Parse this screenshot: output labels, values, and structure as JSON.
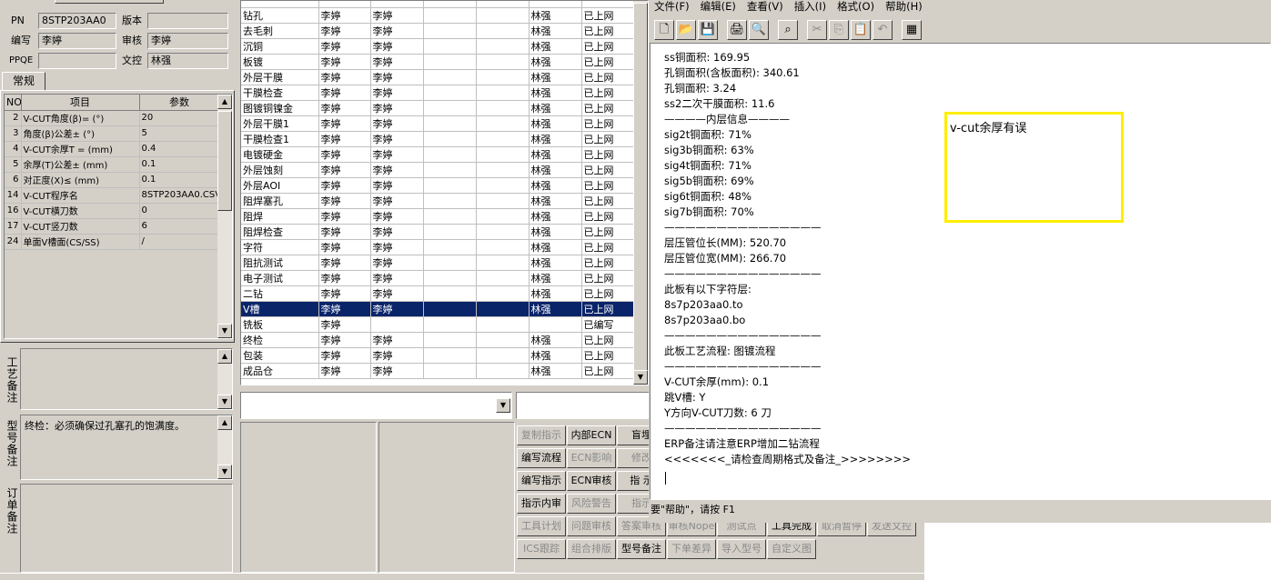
{
  "header": {
    "pn_label": "PN",
    "pn_value": "8STP203AA0",
    "version_label": "版本",
    "version_value": "",
    "author_label": "编写",
    "author_value": "李婷",
    "review_label": "审核",
    "review_value": "李婷",
    "ppqe_label": "PPQE",
    "ppqe_value": "",
    "doc_ctrl_label": "文控",
    "doc_ctrl_value": "林强"
  },
  "left_tab": "常规",
  "params": {
    "headers": [
      "NO",
      "项目",
      "参数"
    ],
    "rows": [
      {
        "no": "2",
        "item": "V-CUT角度(β)=  (°)",
        "value": "20"
      },
      {
        "no": "3",
        "item": "角度(β)公差±  (°)",
        "value": "5"
      },
      {
        "no": "4",
        "item": "V-CUT余厚T =  (mm)",
        "value": "0.4"
      },
      {
        "no": "5",
        "item": "余厚(T)公差±  (mm)",
        "value": "0.1"
      },
      {
        "no": "6",
        "item": "对正度(X)≤  (mm)",
        "value": "0.1"
      },
      {
        "no": "14",
        "item": "V-CUT程序名",
        "value": "8STP203AA0.CSV"
      },
      {
        "no": "16",
        "item": "V-CUT横刀数",
        "value": "0"
      },
      {
        "no": "17",
        "item": "V-CUT竖刀数",
        "value": "6"
      },
      {
        "no": "24",
        "item": "单面V槽面(CS/SS)",
        "value": "/"
      }
    ]
  },
  "notes": {
    "process_label": "工艺备注",
    "process_text": "",
    "model_label": "型号备注",
    "model_text": "终检：必须确保过孔塞孔的饱满度。",
    "order_label": "订单备注",
    "order_text": ""
  },
  "processes": [
    {
      "name": "钻孔",
      "a": "李婷",
      "b": "李婷",
      "c": "",
      "d": "",
      "e": "林强",
      "status": "已上网"
    },
    {
      "name": "去毛刺",
      "a": "李婷",
      "b": "李婷",
      "c": "",
      "d": "",
      "e": "林强",
      "status": "已上网"
    },
    {
      "name": "沉铜",
      "a": "李婷",
      "b": "李婷",
      "c": "",
      "d": "",
      "e": "林强",
      "status": "已上网"
    },
    {
      "name": "板镀",
      "a": "李婷",
      "b": "李婷",
      "c": "",
      "d": "",
      "e": "林强",
      "status": "已上网"
    },
    {
      "name": "外层干膜",
      "a": "李婷",
      "b": "李婷",
      "c": "",
      "d": "",
      "e": "林强",
      "status": "已上网"
    },
    {
      "name": "干膜检查",
      "a": "李婷",
      "b": "李婷",
      "c": "",
      "d": "",
      "e": "林强",
      "status": "已上网"
    },
    {
      "name": "图镀铜镍金",
      "a": "李婷",
      "b": "李婷",
      "c": "",
      "d": "",
      "e": "林强",
      "status": "已上网"
    },
    {
      "name": "外层干膜1",
      "a": "李婷",
      "b": "李婷",
      "c": "",
      "d": "",
      "e": "林强",
      "status": "已上网"
    },
    {
      "name": "干膜检查1",
      "a": "李婷",
      "b": "李婷",
      "c": "",
      "d": "",
      "e": "林强",
      "status": "已上网"
    },
    {
      "name": "电镀硬金",
      "a": "李婷",
      "b": "李婷",
      "c": "",
      "d": "",
      "e": "林强",
      "status": "已上网"
    },
    {
      "name": "外层蚀刻",
      "a": "李婷",
      "b": "李婷",
      "c": "",
      "d": "",
      "e": "林强",
      "status": "已上网"
    },
    {
      "name": "外层AOI",
      "a": "李婷",
      "b": "李婷",
      "c": "",
      "d": "",
      "e": "林强",
      "status": "已上网"
    },
    {
      "name": "阻焊塞孔",
      "a": "李婷",
      "b": "李婷",
      "c": "",
      "d": "",
      "e": "林强",
      "status": "已上网"
    },
    {
      "name": "阻焊",
      "a": "李婷",
      "b": "李婷",
      "c": "",
      "d": "",
      "e": "林强",
      "status": "已上网"
    },
    {
      "name": "阻焊检查",
      "a": "李婷",
      "b": "李婷",
      "c": "",
      "d": "",
      "e": "林强",
      "status": "已上网"
    },
    {
      "name": "字符",
      "a": "李婷",
      "b": "李婷",
      "c": "",
      "d": "",
      "e": "林强",
      "status": "已上网"
    },
    {
      "name": "阻抗测试",
      "a": "李婷",
      "b": "李婷",
      "c": "",
      "d": "",
      "e": "林强",
      "status": "已上网"
    },
    {
      "name": "电子测试",
      "a": "李婷",
      "b": "李婷",
      "c": "",
      "d": "",
      "e": "林强",
      "status": "已上网"
    },
    {
      "name": "二钻",
      "a": "李婷",
      "b": "李婷",
      "c": "",
      "d": "",
      "e": "林强",
      "status": "已上网"
    },
    {
      "name": "V槽",
      "a": "李婷",
      "b": "李婷",
      "c": "",
      "d": "",
      "e": "林强",
      "status": "已上网"
    },
    {
      "name": "铣板",
      "a": "李婷",
      "b": "",
      "c": "",
      "d": "",
      "e": "",
      "status": "已编写"
    },
    {
      "name": "终检",
      "a": "李婷",
      "b": "李婷",
      "c": "",
      "d": "",
      "e": "林强",
      "status": "已上网"
    },
    {
      "name": "包装",
      "a": "李婷",
      "b": "李婷",
      "c": "",
      "d": "",
      "e": "林强",
      "status": "已上网"
    },
    {
      "name": "成品仓",
      "a": "李婷",
      "b": "李婷",
      "c": "",
      "d": "",
      "e": "林强",
      "status": "已上网"
    }
  ],
  "buttons": [
    [
      {
        "label": "复制指示",
        "enabled": false
      },
      {
        "label": "内部ECN",
        "enabled": true
      },
      {
        "label": "盲埋",
        "enabled": true
      }
    ],
    [
      {
        "label": "编写流程",
        "enabled": true
      },
      {
        "label": "ECN影响",
        "enabled": false
      },
      {
        "label": "修改",
        "enabled": false
      }
    ],
    [
      {
        "label": "编写指示",
        "enabled": true
      },
      {
        "label": "ECN审核",
        "enabled": true
      },
      {
        "label": "指 示",
        "enabled": true
      }
    ],
    [
      {
        "label": "指示内审",
        "enabled": true
      },
      {
        "label": "风险警告",
        "enabled": false
      },
      {
        "label": "指示",
        "enabled": false
      }
    ],
    [
      {
        "label": "工具计划",
        "enabled": false
      },
      {
        "label": "问题审核",
        "enabled": false
      },
      {
        "label": "答案审核",
        "enabled": false
      },
      {
        "label": "审核Nope",
        "enabled": false
      },
      {
        "label": "测试点",
        "enabled": false
      },
      {
        "label": "工具完成",
        "enabled": true
      },
      {
        "label": "取消暂停",
        "enabled": false
      },
      {
        "label": "发送文控",
        "enabled": false
      }
    ],
    [
      {
        "label": "ICS跟踪",
        "enabled": false
      },
      {
        "label": "组合排版",
        "enabled": false
      },
      {
        "label": "型号备注",
        "enabled": true
      },
      {
        "label": "下单差异",
        "enabled": false
      },
      {
        "label": "导入型号",
        "enabled": false
      },
      {
        "label": "自定义图",
        "enabled": false
      }
    ]
  ],
  "editor": {
    "menu": [
      "文件(F)",
      "编辑(E)",
      "查看(V)",
      "插入(I)",
      "格式(O)",
      "帮助(H)"
    ],
    "toolbar": [
      "new-icon",
      "open-icon",
      "save-icon",
      "print-icon",
      "preview-icon",
      "find-icon",
      "cut-icon",
      "copy-icon",
      "paste-icon",
      "undo-icon",
      "datetime-icon"
    ],
    "lines": [
      "ss铜面积: 169.95",
      "孔铜面积(含板面积): 340.61",
      "孔铜面积: 3.24",
      "ss2二次干膜面积: 11.6",
      "————内层信息————",
      "sig2t铜面积: 71%",
      "sig3b铜面积: 63%",
      "sig4t铜面积: 71%",
      "sig5b铜面积: 69%",
      "sig6t铜面积: 48%",
      "sig7b铜面积: 70%",
      "———————————————",
      "层压管位长(MM): 520.70",
      "层压管位宽(MM): 266.70",
      "———————————————",
      "此板有以下字符层:",
      "8s7p203aa0.to",
      "8s7p203aa0.bo",
      "———————————————",
      "此板工艺流程: 图镀流程",
      "———————————————",
      "V-CUT余厚(mm): 0.1",
      "跳V槽: Y",
      "Y方向V-CUT刀数: 6 刀",
      "———————————————",
      "ERP备注请注意ERP增加二钻流程",
      "<<<<<<<_请检查周期格式及备注_>>>>>>>>"
    ],
    "annotation": "v-cut余厚有误",
    "status": "要\"帮助\"，请按 F1"
  },
  "colors": {
    "selection": "#0a246a",
    "annotation_border": "#ffee00",
    "window_bg": "#d4d0c8"
  }
}
